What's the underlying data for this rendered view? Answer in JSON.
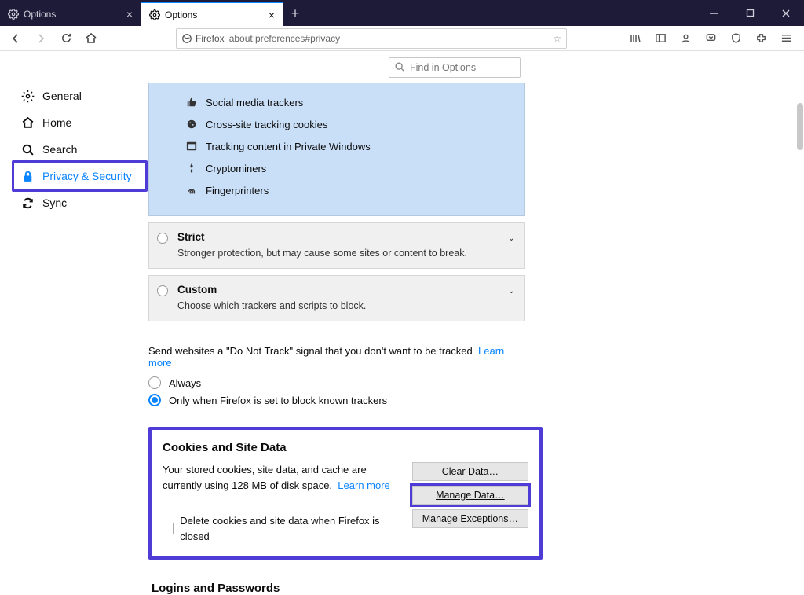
{
  "tabs": {
    "inactive": "Options",
    "active": "Options"
  },
  "url": {
    "identity": "Firefox",
    "address": "about:preferences#privacy"
  },
  "search_placeholder": "Find in Options",
  "sidebar": {
    "general": "General",
    "home": "Home",
    "search": "Search",
    "privacy": "Privacy & Security",
    "sync": "Sync"
  },
  "trackers": {
    "social": "Social media trackers",
    "cross": "Cross-site tracking cookies",
    "private": "Tracking content in Private Windows",
    "crypto": "Cryptominers",
    "finger": "Fingerprinters"
  },
  "strict": {
    "title": "Strict",
    "desc": "Stronger protection, but may cause some sites or content to break."
  },
  "custom": {
    "title": "Custom",
    "desc": "Choose which trackers and scripts to block."
  },
  "dnt": {
    "text": "Send websites a \"Do Not Track\" signal that you don't want to be tracked",
    "learn": "Learn more",
    "always": "Always",
    "onlywhen": "Only when Firefox is set to block known trackers"
  },
  "cookies": {
    "heading": "Cookies and Site Data",
    "desc1": "Your stored cookies, site data, and cache are currently using 128 MB of disk space.",
    "learn": "Learn more",
    "clear": "Clear Data…",
    "manage": "Manage Data…",
    "exceptions": "Manage Exceptions…",
    "delete": "Delete cookies and site data when Firefox is closed"
  },
  "logins_heading": "Logins and Passwords"
}
